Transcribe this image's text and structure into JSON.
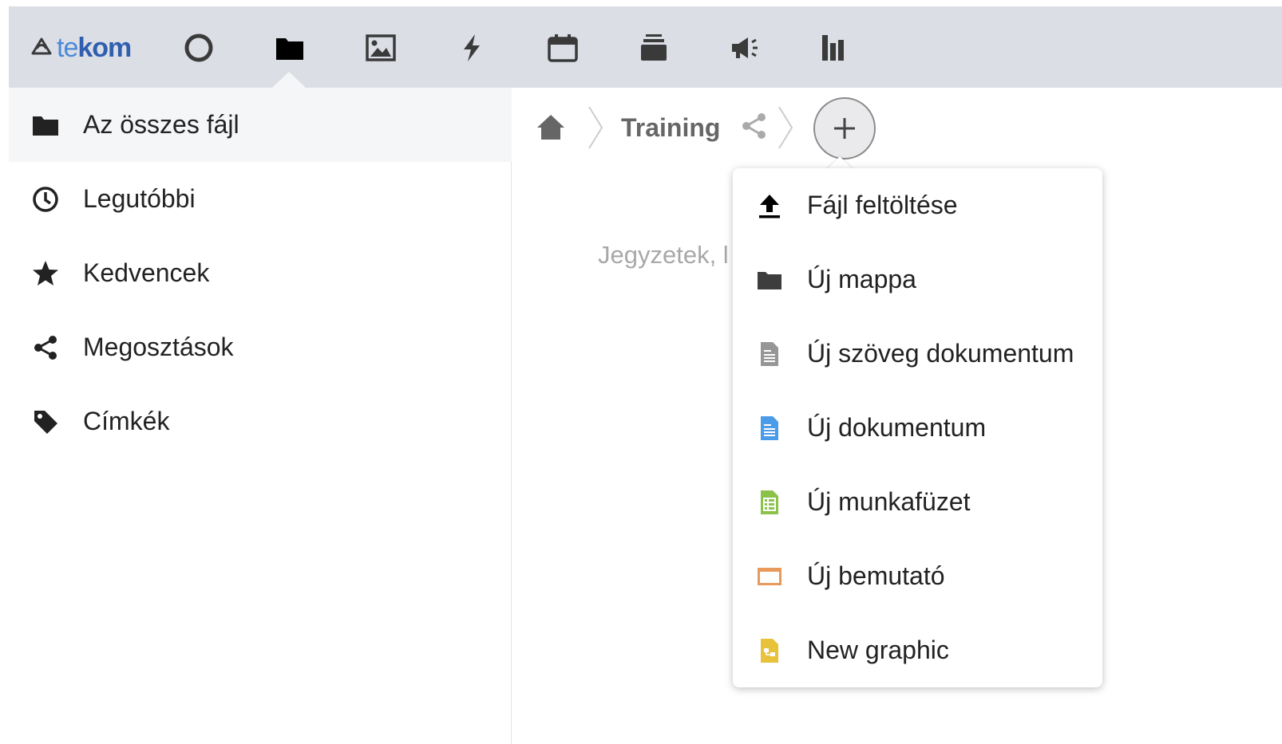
{
  "header": {
    "logo": {
      "part1": "te",
      "part2": "kom",
      "icon": "tekom-logo-icon"
    },
    "apps": [
      {
        "name": "dashboard",
        "icon": "circle-icon"
      },
      {
        "name": "files",
        "icon": "folder-icon",
        "active": true
      },
      {
        "name": "photos",
        "icon": "image-icon"
      },
      {
        "name": "activity",
        "icon": "lightning-icon"
      },
      {
        "name": "calendar",
        "icon": "calendar-icon"
      },
      {
        "name": "deck",
        "icon": "stack-icon"
      },
      {
        "name": "announcements",
        "icon": "megaphone-icon"
      },
      {
        "name": "analytics",
        "icon": "bar-chart-icon"
      }
    ]
  },
  "sidebar": {
    "items": [
      {
        "label": "Az összes fájl",
        "icon": "folder-icon",
        "active": true
      },
      {
        "label": "Legutóbbi",
        "icon": "clock-icon"
      },
      {
        "label": "Kedvencek",
        "icon": "star-icon"
      },
      {
        "label": "Megosztások",
        "icon": "share-icon"
      },
      {
        "label": "Címkék",
        "icon": "tag-icon"
      }
    ]
  },
  "breadcrumb": {
    "home_icon": "home-icon",
    "folder": "Training",
    "share_icon": "share-icon",
    "new_button_icon": "plus-icon"
  },
  "main": {
    "empty_hint": "Jegyzetek, l                                                    dása..."
  },
  "new_menu": {
    "items": [
      {
        "label": "Fájl feltöltése",
        "icon": "upload-icon",
        "color": "#000000"
      },
      {
        "label": "Új mappa",
        "icon": "folder-icon",
        "color": "#3d3d3d"
      },
      {
        "label": "Új szöveg dokumentum",
        "icon": "text-file-icon",
        "color": "#969696"
      },
      {
        "label": "Új dokumentum",
        "icon": "document-icon",
        "color": "#4a9be8"
      },
      {
        "label": "Új munkafüzet",
        "icon": "spreadsheet-icon",
        "color": "#8bc34a"
      },
      {
        "label": "Új bemutató",
        "icon": "presentation-icon",
        "color": "#e79a5c"
      },
      {
        "label": "New graphic",
        "icon": "graphic-icon",
        "color": "#e8c23a"
      }
    ]
  },
  "colors": {
    "header_bg": "#dcdee6",
    "sidebar_active_bg": "#f5f6f8",
    "logo_light": "#4a89d9",
    "logo_dark": "#2f5fae"
  }
}
